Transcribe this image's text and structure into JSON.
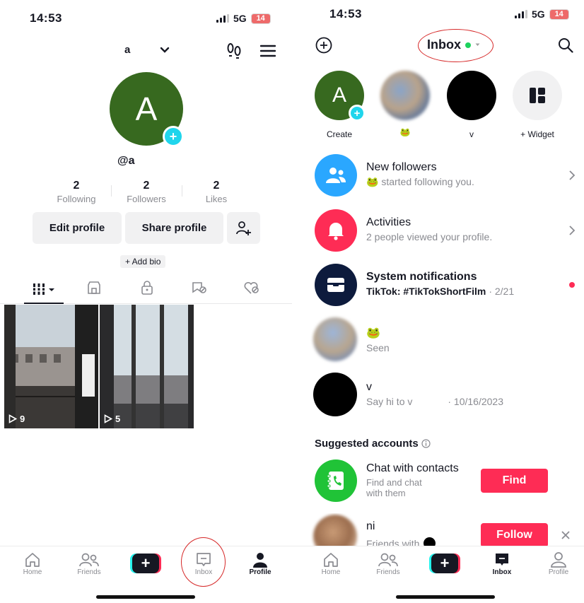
{
  "left": {
    "status": {
      "time": "14:53",
      "network": "5G",
      "battery": "14"
    },
    "header": {
      "username": "a"
    },
    "profile": {
      "avatar_letter": "A",
      "handle": "@a"
    },
    "stats": [
      {
        "value": "2",
        "label": "Following"
      },
      {
        "value": "2",
        "label": "Followers"
      },
      {
        "value": "2",
        "label": "Likes"
      }
    ],
    "buttons": {
      "edit": "Edit profile",
      "share": "Share profile"
    },
    "add_bio": "+ Add bio",
    "videos": [
      {
        "views": "9"
      },
      {
        "views": "5"
      }
    ],
    "tabbar": [
      {
        "label": "Home"
      },
      {
        "label": "Friends"
      },
      {
        "label": "Inbox"
      },
      {
        "label": "Profile"
      }
    ]
  },
  "right": {
    "status": {
      "time": "14:53",
      "network": "5G",
      "battery": "14"
    },
    "header": {
      "title": "Inbox"
    },
    "stories": [
      {
        "label": "Create",
        "letter": "A"
      },
      {
        "label": "🐸"
      },
      {
        "label": "v"
      },
      {
        "label": "+ Widget"
      }
    ],
    "rows": [
      {
        "title": "New followers",
        "subtitle": "🐸 started following you."
      },
      {
        "title": "Activities",
        "subtitle": "2 people viewed your profile."
      },
      {
        "title": "System notifications",
        "subtitle": "TikTok: #TikTokShortFilm",
        "meta": "· 2/21"
      },
      {
        "title": "🐸",
        "subtitle": "Seen"
      },
      {
        "title": "v",
        "subtitle": "Say hi to v",
        "meta": "· 10/16/2023"
      }
    ],
    "suggested": {
      "heading": "Suggested accounts",
      "items": [
        {
          "title": "Chat with contacts",
          "subtitle": "Find and chat with them",
          "button": "Find"
        },
        {
          "title": "ni",
          "subtitle": "Friends with",
          "button": "Follow"
        }
      ]
    },
    "tabbar": [
      {
        "label": "Home"
      },
      {
        "label": "Friends"
      },
      {
        "label": "Inbox"
      },
      {
        "label": "Profile"
      }
    ]
  },
  "colors": {
    "accent_pink": "#fe2c55",
    "accent_cyan": "#20d5ec",
    "avatar_green": "#37691f",
    "annotation_red": "#d62828"
  }
}
